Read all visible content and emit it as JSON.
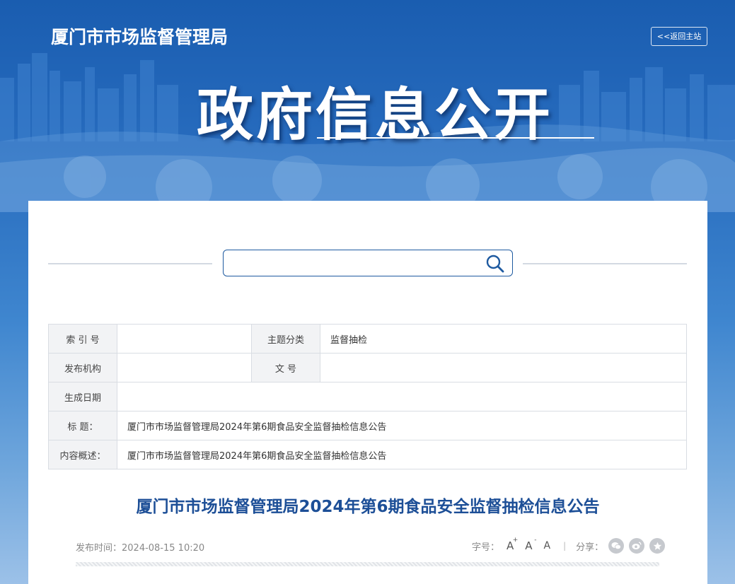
{
  "header": {
    "site_title": "厦门市市场监督管理局",
    "back_home": "<<返回主站",
    "banner_title": "政府信息公开"
  },
  "search": {
    "placeholder": ""
  },
  "info_table": {
    "index_label": "索 引 号",
    "index_value": "",
    "topic_label": "主题分类",
    "topic_value": "监督抽检",
    "publisher_label": "发布机构",
    "publisher_value": "",
    "doc_no_label": "文 号",
    "doc_no_value": "",
    "date_label": "生成日期",
    "date_value": "",
    "title_label": "标 题：",
    "title_value": "厦门市市场监督管理局2024年第6期食品安全监督抽检信息公告",
    "summary_label": "内容概述：",
    "summary_value": "厦门市市场监督管理局2024年第6期食品安全监督抽检信息公告"
  },
  "article": {
    "title": "厦门市市场监督管理局2024年第6期食品安全监督抽检信息公告",
    "publish_time": "发布时间：2024-08-15 10:20",
    "font_size_label": "字号：",
    "font_large": "A",
    "font_medium": "A",
    "font_small": "A",
    "font_plus": "+",
    "font_minus": "-",
    "divider": "|",
    "share_label": "分享："
  },
  "icons": {
    "search": "search-icon",
    "share_wechat": "wechat-icon",
    "share_weibo": "weibo-icon",
    "share_favorite": "star-icon"
  },
  "colors": {
    "brand_blue": "#1d4f97",
    "banner_blue": "#1a5fb0"
  }
}
